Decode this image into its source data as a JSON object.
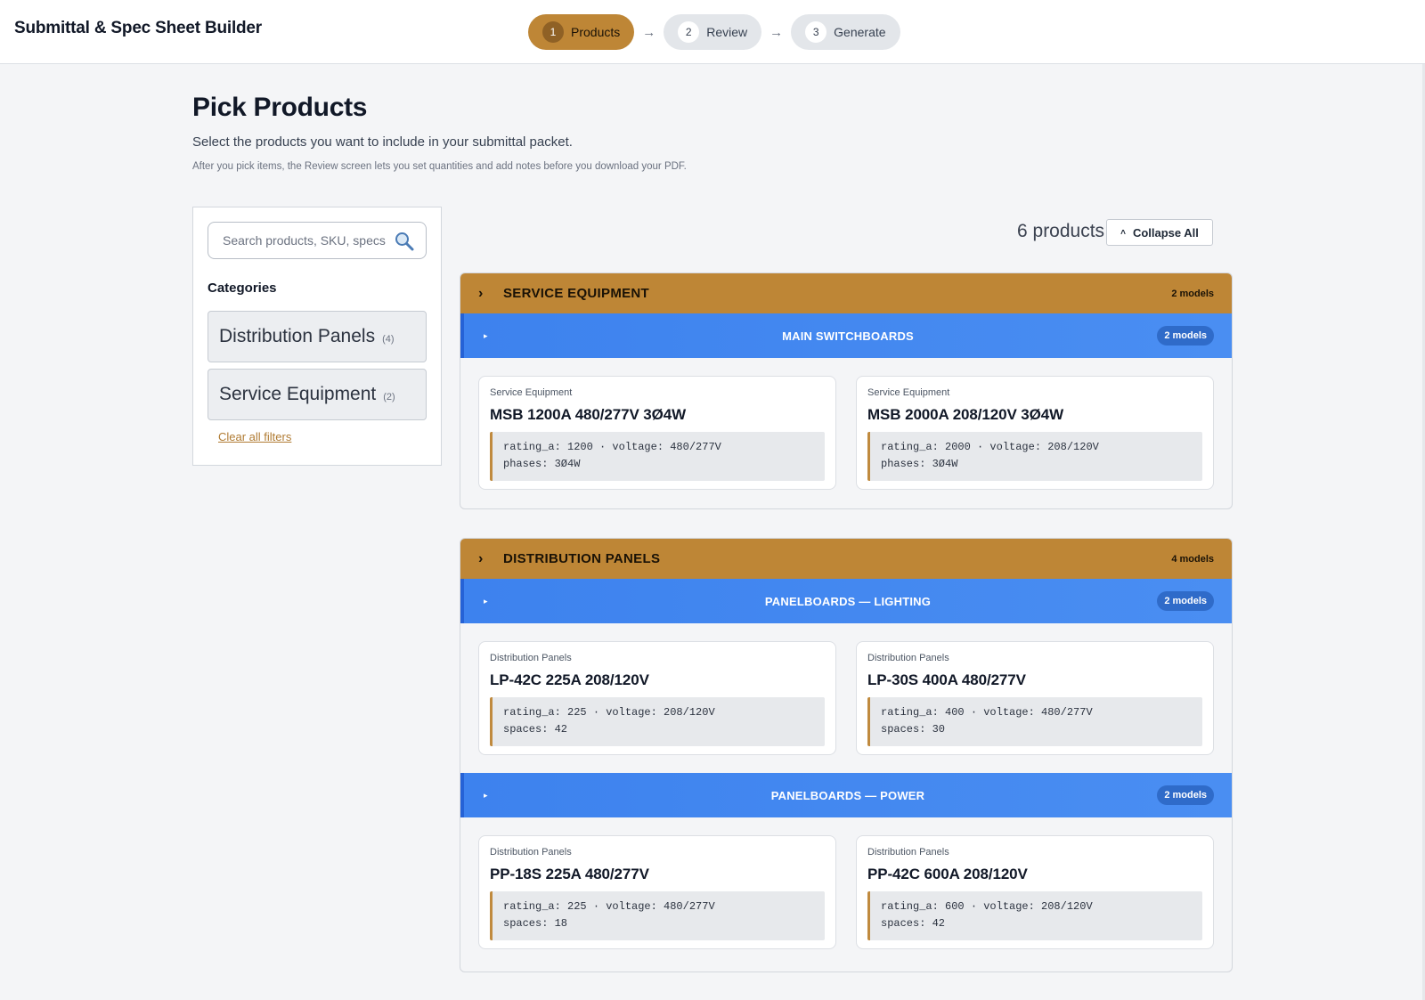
{
  "header": {
    "app_title": "Submittal & Spec Sheet Builder",
    "steps": [
      {
        "num": "1",
        "label": "Products",
        "active": true
      },
      {
        "num": "2",
        "label": "Review",
        "active": false
      },
      {
        "num": "3",
        "label": "Generate",
        "active": false
      }
    ],
    "arrow": "→"
  },
  "intro": {
    "title": "Pick Products",
    "subtitle": "Select the products you want to include in your submittal packet.",
    "hint": "After you pick items, the Review screen lets you set quantities and add notes before you download your PDF."
  },
  "sidebar": {
    "search_placeholder": "Search products, SKU, specs",
    "search_icon": "search-icon",
    "categories_heading": "Categories",
    "categories": [
      {
        "label": "Distribution Panels",
        "count": "(4)"
      },
      {
        "label": "Service Equipment",
        "count": "(2)"
      }
    ],
    "clear_label": "Clear all filters"
  },
  "results": {
    "count_label": "6 products",
    "collapse_label": "Collapse All",
    "groups": [
      {
        "name": "SERVICE EQUIPMENT",
        "models": "2 models",
        "subgroups": [
          {
            "name": "MAIN SWITCHBOARDS",
            "models": "2 models",
            "cards": [
              {
                "category": "Service Equipment",
                "title": "MSB 1200A 480/277V 3Ø4W",
                "spec1": "rating_a: 1200 · voltage: 480/277V",
                "spec2": "phases: 3Ø4W"
              },
              {
                "category": "Service Equipment",
                "title": "MSB 2000A 208/120V 3Ø4W",
                "spec1": "rating_a: 2000 · voltage: 208/120V",
                "spec2": "phases: 3Ø4W"
              }
            ]
          }
        ]
      },
      {
        "name": "DISTRIBUTION PANELS",
        "models": "4 models",
        "subgroups": [
          {
            "name": "PANELBOARDS — LIGHTING",
            "models": "2 models",
            "cards": [
              {
                "category": "Distribution Panels",
                "title": "LP-42C 225A 208/120V",
                "spec1": "rating_a: 225 · voltage: 208/120V",
                "spec2": "spaces: 42"
              },
              {
                "category": "Distribution Panels",
                "title": "LP-30S 400A 480/277V",
                "spec1": "rating_a: 400 · voltage: 480/277V",
                "spec2": "spaces: 30"
              }
            ]
          },
          {
            "name": "PANELBOARDS — POWER",
            "models": "2 models",
            "cards": [
              {
                "category": "Distribution Panels",
                "title": "PP-18S 225A 480/277V",
                "spec1": "rating_a: 225 · voltage: 480/277V",
                "spec2": "spaces: 18"
              },
              {
                "category": "Distribution Panels",
                "title": "PP-42C 600A 208/120V",
                "spec1": "rating_a: 600 · voltage: 208/120V",
                "spec2": "spaces: 42"
              }
            ]
          }
        ]
      }
    ]
  },
  "colors": {
    "accent": "#be8636",
    "subheader_blue": "#3d82ee",
    "page_bg": "#f4f5f7"
  }
}
